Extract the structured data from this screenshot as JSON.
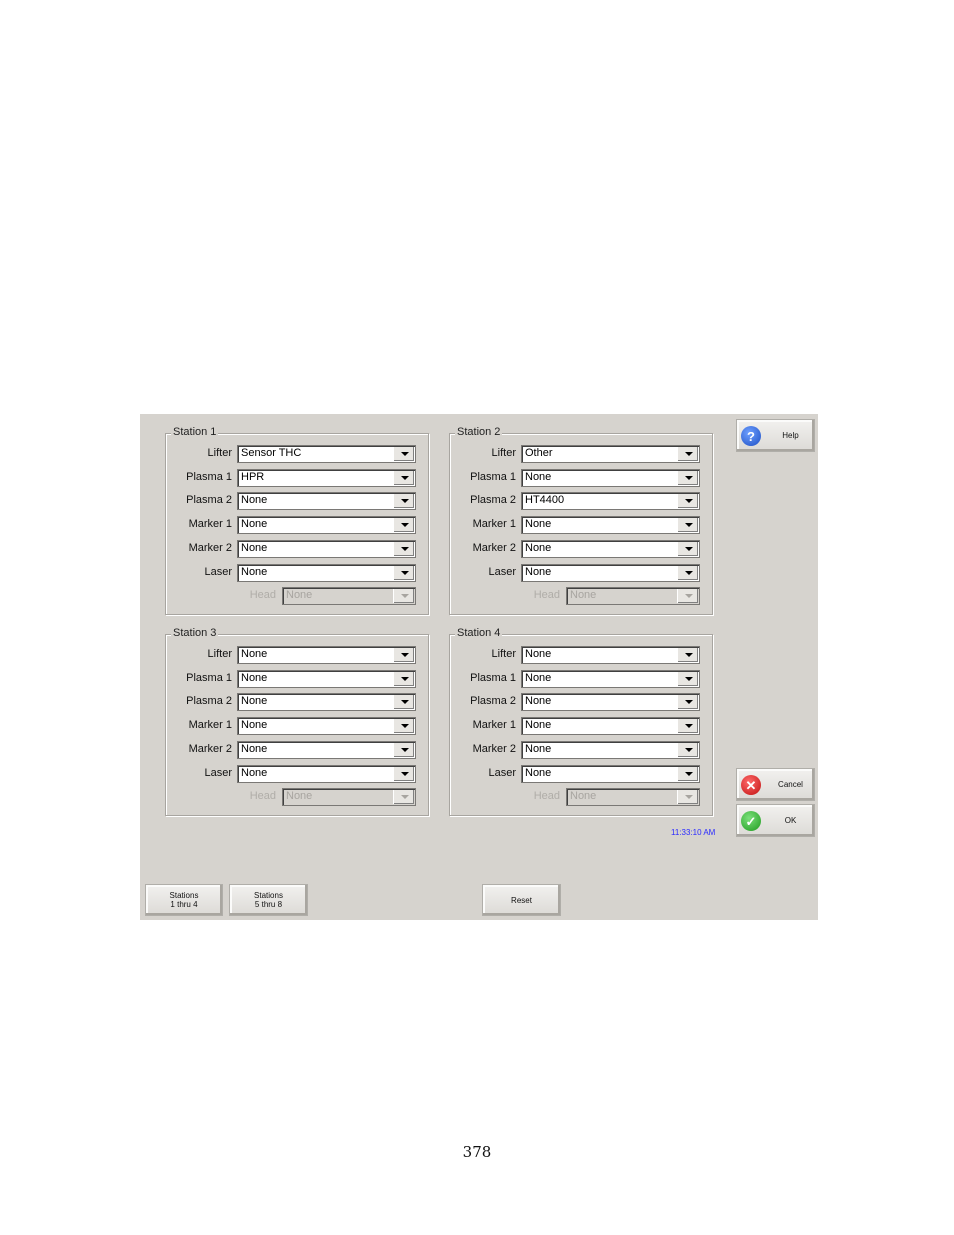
{
  "stations": [
    {
      "title": "Station 1",
      "fields": [
        {
          "label": "Lifter",
          "value": "Sensor THC"
        },
        {
          "label": "Plasma 1",
          "value": "HPR"
        },
        {
          "label": "Plasma 2",
          "value": "None"
        },
        {
          "label": "Marker 1",
          "value": "None"
        },
        {
          "label": "Marker 2",
          "value": "None"
        },
        {
          "label": "Laser",
          "value": "None"
        }
      ],
      "head": {
        "label": "Head",
        "value": "None",
        "disabled": true
      }
    },
    {
      "title": "Station 2",
      "fields": [
        {
          "label": "Lifter",
          "value": "Other"
        },
        {
          "label": "Plasma 1",
          "value": "None"
        },
        {
          "label": "Plasma 2",
          "value": "HT4400"
        },
        {
          "label": "Marker 1",
          "value": "None"
        },
        {
          "label": "Marker 2",
          "value": "None"
        },
        {
          "label": "Laser",
          "value": "None"
        }
      ],
      "head": {
        "label": "Head",
        "value": "None",
        "disabled": true
      }
    },
    {
      "title": "Station 3",
      "fields": [
        {
          "label": "Lifter",
          "value": "None"
        },
        {
          "label": "Plasma 1",
          "value": "None"
        },
        {
          "label": "Plasma 2",
          "value": "None"
        },
        {
          "label": "Marker 1",
          "value": "None"
        },
        {
          "label": "Marker 2",
          "value": "None"
        },
        {
          "label": "Laser",
          "value": "None"
        }
      ],
      "head": {
        "label": "Head",
        "value": "None",
        "disabled": true
      }
    },
    {
      "title": "Station 4",
      "fields": [
        {
          "label": "Lifter",
          "value": "None"
        },
        {
          "label": "Plasma 1",
          "value": "None"
        },
        {
          "label": "Plasma 2",
          "value": "None"
        },
        {
          "label": "Marker 1",
          "value": "None"
        },
        {
          "label": "Marker 2",
          "value": "None"
        },
        {
          "label": "Laser",
          "value": "None"
        }
      ],
      "head": {
        "label": "Head",
        "value": "None",
        "disabled": true
      }
    }
  ],
  "buttons": {
    "help": "Help",
    "cancel": "Cancel",
    "ok": "OK",
    "reset": "Reset",
    "stations_1_4": {
      "line1": "Stations",
      "line2": "1 thru 4"
    },
    "stations_5_8": {
      "line1": "Stations",
      "line2": "5 thru 8"
    }
  },
  "clock": "11:33:10 AM",
  "page_number": "378"
}
